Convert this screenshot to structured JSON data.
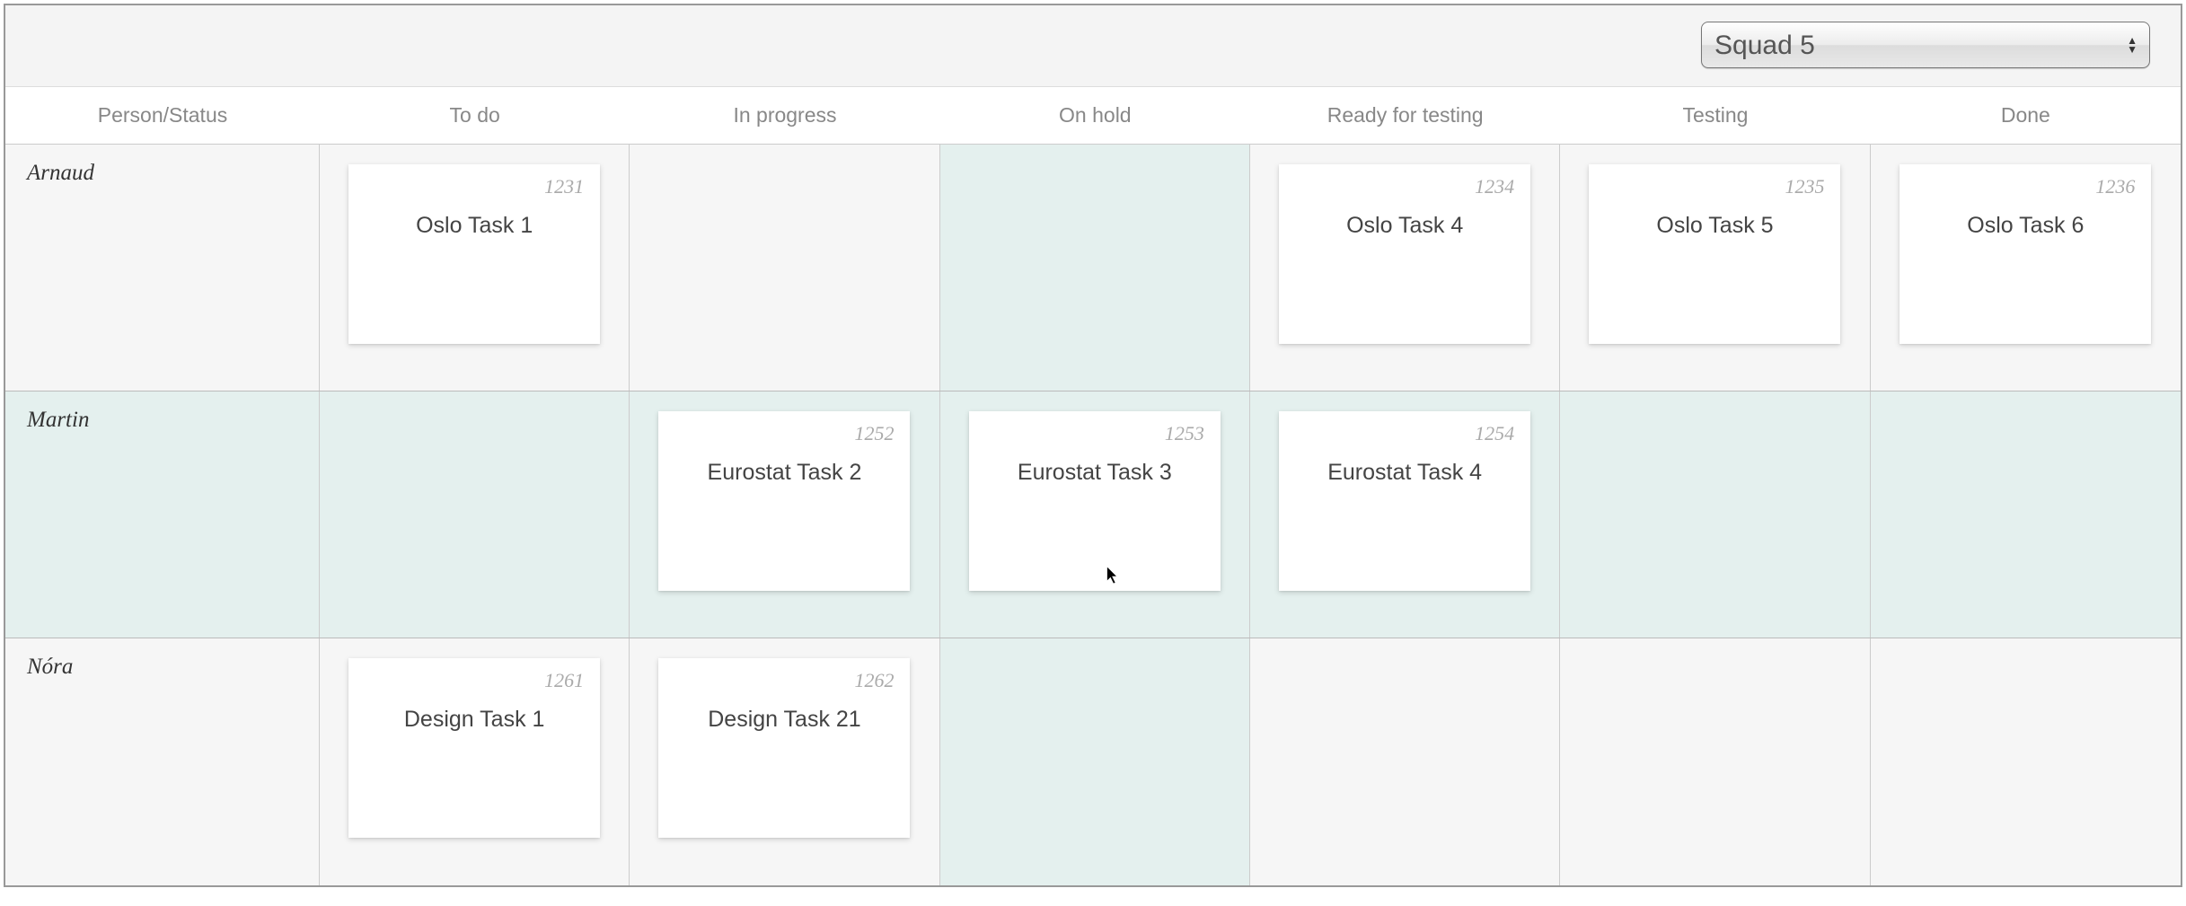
{
  "toolbar": {
    "squad_selected": "Squad 5"
  },
  "columns": [
    "Person/Status",
    "To do",
    "In progress",
    "On hold",
    "Ready for testing",
    "Testing",
    "Done"
  ],
  "rows": [
    {
      "person": "Arnaud",
      "alt": false,
      "cells": [
        [
          {
            "id": "1231",
            "title": "Oslo Task 1"
          }
        ],
        [],
        [],
        [
          {
            "id": "1234",
            "title": "Oslo Task 4"
          }
        ],
        [
          {
            "id": "1235",
            "title": "Oslo Task 5"
          }
        ],
        [
          {
            "id": "1236",
            "title": "Oslo Task 6"
          }
        ]
      ]
    },
    {
      "person": "Martin",
      "alt": true,
      "cells": [
        [],
        [
          {
            "id": "1252",
            "title": "Eurostat Task 2"
          }
        ],
        [
          {
            "id": "1253",
            "title": "Eurostat Task 3"
          }
        ],
        [
          {
            "id": "1254",
            "title": "Eurostat Task 4"
          }
        ],
        [],
        []
      ]
    },
    {
      "person": "Nóra",
      "alt": false,
      "cells": [
        [
          {
            "id": "1261",
            "title": "Design Task 1"
          }
        ],
        [
          {
            "id": "1262",
            "title": "Design Task 21"
          }
        ],
        [],
        [],
        [],
        []
      ]
    }
  ]
}
